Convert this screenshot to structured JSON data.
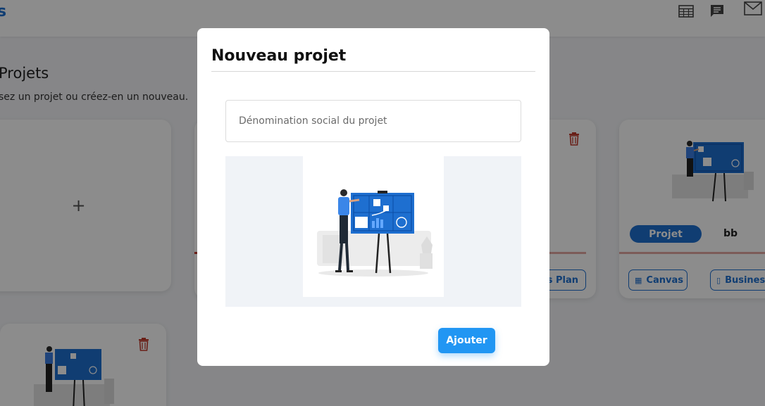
{
  "app": {
    "logo_fragment": "s"
  },
  "header_icons": [
    "table-icon",
    "chat-icon",
    "mail-icon"
  ],
  "page": {
    "title": "Projets",
    "subtitle": "sez un projet ou créez-en un nouveau."
  },
  "cards": {
    "new_card": {
      "plus": "+"
    },
    "mid_card": {
      "button_label": "ss Plan"
    },
    "right_card": {
      "badge": "Projet",
      "name": "bb",
      "buttons": [
        {
          "label": "Canvas",
          "icon": "grid-icon"
        },
        {
          "label": "Business",
          "icon": "book-icon"
        }
      ]
    }
  },
  "modal": {
    "title": "Nouveau projet",
    "input": {
      "placeholder": "Dénomination social du projet",
      "value": ""
    },
    "submit_label": "Ajouter"
  },
  "colors": {
    "brand": "#1e6fd0",
    "primary_button": "#2196f3",
    "danger": "#c0392b",
    "overlay": "rgba(0,0,0,0.45)"
  }
}
